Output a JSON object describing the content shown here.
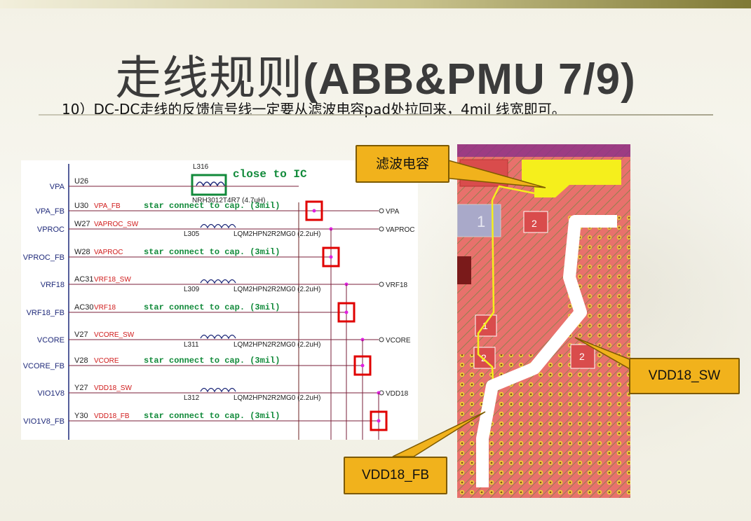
{
  "slide": {
    "title_cn": "走线规则",
    "title_en": "(ABB&PMU 7/9)",
    "subtitle": "10）DC-DC走线的反馈信号线一定要从滤波电容pad处拉回来，4mil 线宽即可。"
  },
  "schematic": {
    "close_to_ic": "close to IC",
    "inductor_top": {
      "ref": "L316",
      "part": "NRH3012T4R7 (4.7uH)"
    },
    "rows": [
      {
        "label": "VPA",
        "pin": "U26",
        "net": "",
        "note": "",
        "out": ""
      },
      {
        "label": "VPA_FB",
        "pin": "U30",
        "net": "VPA_FB",
        "note": "star connect to cap. (3mil)",
        "out": "VPA"
      },
      {
        "label": "VPROC",
        "pin": "W27",
        "net": "VAPROC_SW",
        "note": "",
        "out": "VAPROC",
        "ref": "L305",
        "part": "LQM2HPN2R2MG0 (2.2uH)"
      },
      {
        "label": "VPROC_FB",
        "pin": "W28",
        "net": "VAPROC",
        "note": "star connect to cap. (3mil)",
        "out": ""
      },
      {
        "label": "VRF18",
        "pin": "AC31",
        "net": "VRF18_SW",
        "note": "",
        "out": "VRF18",
        "ref": "L309",
        "part": "LQM2HPN2R2MG0 (2.2uH)"
      },
      {
        "label": "VRF18_FB",
        "pin": "AC30",
        "net": "VRF18",
        "note": "star connect to cap. (3mil)",
        "out": ""
      },
      {
        "label": "VCORE",
        "pin": "V27",
        "net": "VCORE_SW",
        "note": "",
        "out": "VCORE",
        "ref": "L311",
        "part": "LQM2HPN2R2MG0 (2.2uH)"
      },
      {
        "label": "VCORE_FB",
        "pin": "V28",
        "net": "VCORE",
        "note": "star connect to cap. (3mil)",
        "out": ""
      },
      {
        "label": "VIO1V8",
        "pin": "Y27",
        "net": "VDD18_SW",
        "note": "",
        "out": "VDD18",
        "ref": "L312",
        "part": "LQM2HPN2R2MG0 (2.2uH)"
      },
      {
        "label": "VIO1V8_FB",
        "pin": "Y30",
        "net": "VDD18_FB",
        "note": "star connect to cap. (3mil)",
        "out": ""
      }
    ]
  },
  "pcb": {
    "pad_labels": [
      "2",
      "1",
      "2",
      "1",
      "2",
      "2"
    ]
  },
  "callouts": {
    "filter_cap": "滤波电容",
    "vdd18_sw": "VDD18_SW",
    "vdd18_fb": "VDD18_FB"
  },
  "colors": {
    "accent_callout": "#f1b21c",
    "schematic_net": "#d01a1a",
    "schematic_note": "#118a3a",
    "pcb_copper": "#e8716c",
    "highlight_box": "#e00000"
  }
}
